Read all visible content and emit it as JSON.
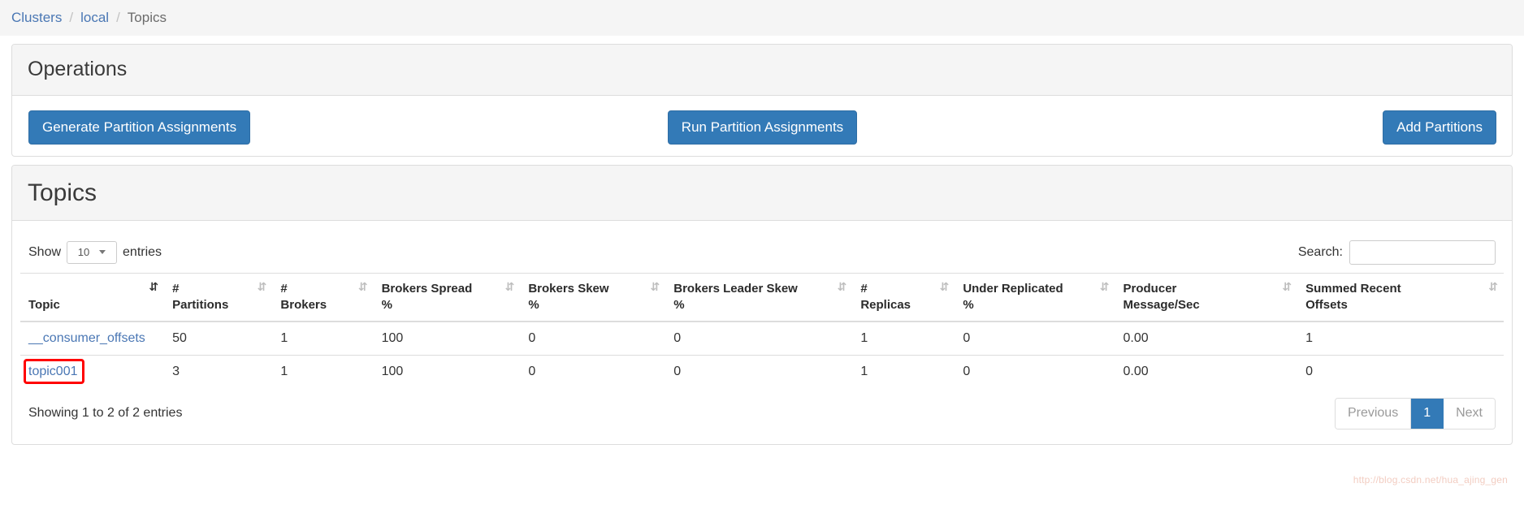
{
  "breadcrumb": {
    "items": [
      {
        "label": "Clusters",
        "link": true
      },
      {
        "label": "local",
        "link": true
      },
      {
        "label": "Topics",
        "link": false
      }
    ],
    "separator": "/"
  },
  "operations": {
    "title": "Operations",
    "buttons": [
      {
        "label": "Generate Partition Assignments",
        "name": "generate-partition-assignments-button"
      },
      {
        "label": "Run Partition Assignments",
        "name": "run-partition-assignments-button"
      },
      {
        "label": "Add Partitions",
        "name": "add-partitions-button"
      }
    ]
  },
  "topics": {
    "title": "Topics",
    "length_menu": {
      "prefix": "Show",
      "value": "10",
      "suffix": "entries"
    },
    "search": {
      "label": "Search:",
      "value": "",
      "placeholder": ""
    },
    "columns": [
      {
        "line1": "",
        "line2": "Topic",
        "sort": "desc",
        "icon": "sort-desc-icon"
      },
      {
        "line1": "#",
        "line2": "Partitions",
        "sort": "none",
        "icon": "sort-both-icon"
      },
      {
        "line1": "#",
        "line2": "Brokers",
        "sort": "none",
        "icon": "sort-both-icon"
      },
      {
        "line1": "Brokers Spread",
        "line2": "%",
        "sort": "none",
        "icon": "sort-both-icon"
      },
      {
        "line1": "Brokers Skew",
        "line2": "%",
        "sort": "none",
        "icon": "sort-both-icon"
      },
      {
        "line1": "Brokers Leader Skew",
        "line2": "%",
        "sort": "none",
        "icon": "sort-both-icon"
      },
      {
        "line1": "#",
        "line2": "Replicas",
        "sort": "none",
        "icon": "sort-both-icon"
      },
      {
        "line1": "Under Replicated",
        "line2": "%",
        "sort": "none",
        "icon": "sort-both-icon"
      },
      {
        "line1": "Producer",
        "line2": "Message/Sec",
        "sort": "none",
        "icon": "sort-both-icon"
      },
      {
        "line1": "Summed Recent",
        "line2": "Offsets",
        "sort": "none",
        "icon": "sort-both-icon"
      }
    ],
    "rows": [
      {
        "topic": "__consumer_offsets",
        "partitions": "50",
        "brokers": "1",
        "brokers_spread_pct": "100",
        "brokers_skew_pct": "0",
        "brokers_leader_skew_pct": "0",
        "replicas": "1",
        "under_replicated_pct": "0",
        "producer_message_sec": "0.00",
        "summed_recent_offsets": "1",
        "highlighted": false
      },
      {
        "topic": "topic001",
        "partitions": "3",
        "brokers": "1",
        "brokers_spread_pct": "100",
        "brokers_skew_pct": "0",
        "brokers_leader_skew_pct": "0",
        "replicas": "1",
        "under_replicated_pct": "0",
        "producer_message_sec": "0.00",
        "summed_recent_offsets": "0",
        "highlighted": true
      }
    ],
    "info": "Showing 1 to 2 of 2 entries",
    "pagination": {
      "previous": "Previous",
      "pages": [
        "1"
      ],
      "next": "Next",
      "active": "1"
    }
  },
  "watermark": "http://blog.csdn.net/hua_ajing_gen",
  "colors": {
    "primary": "#337ab7",
    "link": "#4a77b4",
    "annotation": "#ff0000",
    "panel_header_bg": "#f5f5f5",
    "border": "#dddddd"
  }
}
